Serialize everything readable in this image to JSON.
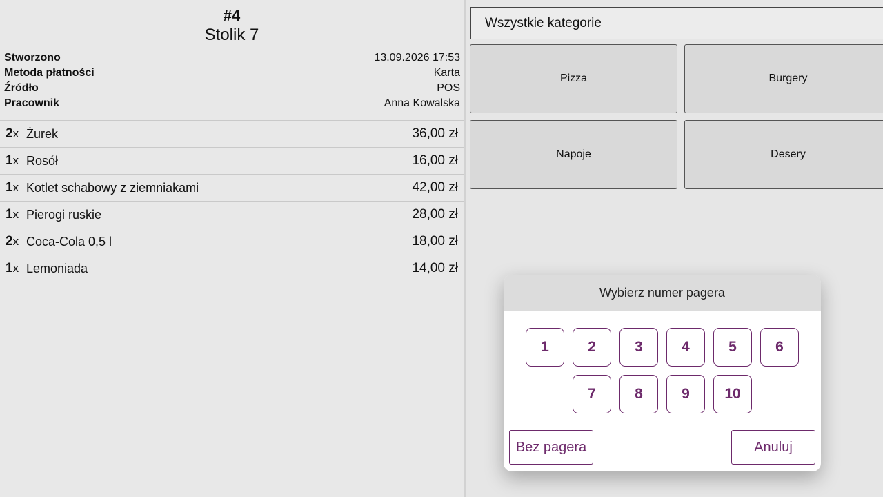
{
  "order": {
    "number": "#4",
    "table": "Stolik 7",
    "meta": [
      {
        "label": "Stworzono",
        "value": "13.09.2026 17:53"
      },
      {
        "label": "Metoda płatności",
        "value": "Karta"
      },
      {
        "label": "Źródło",
        "value": "POS"
      },
      {
        "label": "Pracownik",
        "value": "Anna Kowalska"
      }
    ],
    "items": [
      {
        "qty": "2",
        "x": "x",
        "name": "Żurek",
        "price": "36,00 zł"
      },
      {
        "qty": "1",
        "x": "x",
        "name": "Rosół",
        "price": "16,00 zł"
      },
      {
        "qty": "1",
        "x": "x",
        "name": "Kotlet schabowy z ziemniakami",
        "price": "42,00 zł"
      },
      {
        "qty": "1",
        "x": "x",
        "name": "Pierogi ruskie",
        "price": "28,00 zł"
      },
      {
        "qty": "2",
        "x": "x",
        "name": "Coca-Cola 0,5 l",
        "price": "18,00 zł"
      },
      {
        "qty": "1",
        "x": "x",
        "name": "Lemoniada",
        "price": "14,00 zł"
      }
    ]
  },
  "categories": {
    "select_label": "Wszystkie kategorie",
    "items": [
      "Pizza",
      "Burgery",
      "Napoje",
      "Desery"
    ]
  },
  "pager_modal": {
    "title": "Wybierz numer pagera",
    "numbers": [
      "1",
      "2",
      "3",
      "4",
      "5",
      "6",
      "7",
      "8",
      "9",
      "10"
    ],
    "no_pager_label": "Bez pagera",
    "cancel_label": "Anuluj"
  },
  "colors": {
    "accent": "#6d2a6b",
    "background": "#e6e6e6",
    "category_button": "#d9d9d9",
    "modal_header": "#dcdcdc"
  }
}
